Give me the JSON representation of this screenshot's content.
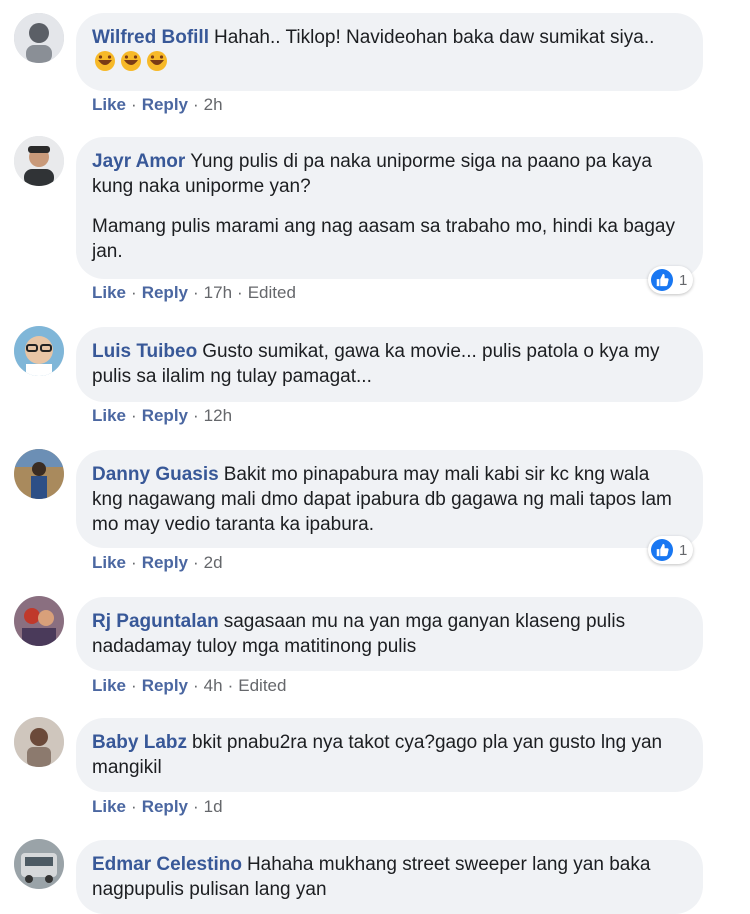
{
  "comments": [
    {
      "author": "Wilfred Bofill",
      "text": "Hahah.. Tiklop! Navideohan baka daw sumikat siya..",
      "emojis": [
        "laughing-emoji",
        "laughing-emoji",
        "laughing-emoji"
      ],
      "actions": {
        "like": "Like",
        "reply": "Reply",
        "time": "2h"
      }
    },
    {
      "author": "Jayr Amor",
      "text": "Yung pulis di pa naka uniporme siga na paano pa kaya kung naka uniporme yan?",
      "text2": "Mamang pulis marami ang nag aasam sa trabaho mo, hindi ka bagay jan.",
      "actions": {
        "like": "Like",
        "reply": "Reply",
        "time": "17h",
        "edited": "Edited"
      },
      "reaction_count": "1"
    },
    {
      "author": "Luis Tuibeo",
      "text": "Gusto sumikat, gawa ka movie... pulis patola o kya my pulis sa ilalim ng tulay pamagat...",
      "actions": {
        "like": "Like",
        "reply": "Reply",
        "time": "12h"
      }
    },
    {
      "author": "Danny Guasis",
      "text": "Bakit mo pinapabura may mali kabi sir kc kng wala kng nagawang mali dmo dapat ipabura db gagawa ng mali tapos lam mo may vedio taranta ka ipabura.",
      "actions": {
        "like": "Like",
        "reply": "Reply",
        "time": "2d"
      },
      "reaction_count": "1"
    },
    {
      "author": "Rj Paguntalan",
      "text": "sagasaan mu na yan mga ganyan klaseng pulis nadadamay tuloy mga matitinong pulis",
      "actions": {
        "like": "Like",
        "reply": "Reply",
        "time": "4h",
        "edited": "Edited"
      }
    },
    {
      "author": "Baby Labz",
      "text": "bkit pnabu2ra nya takot cya?gago pla yan gusto lng yan mangikil",
      "actions": {
        "like": "Like",
        "reply": "Reply",
        "time": "1d"
      }
    },
    {
      "author": "Edmar Celestino",
      "text": "Hahaha mukhang street sweeper lang yan baka nagpupulis pulisan lang yan"
    }
  ],
  "separator": "·",
  "colors": {
    "author": "#385898",
    "bubble": "#f0f2f5",
    "like_badge": "#1877f2"
  }
}
